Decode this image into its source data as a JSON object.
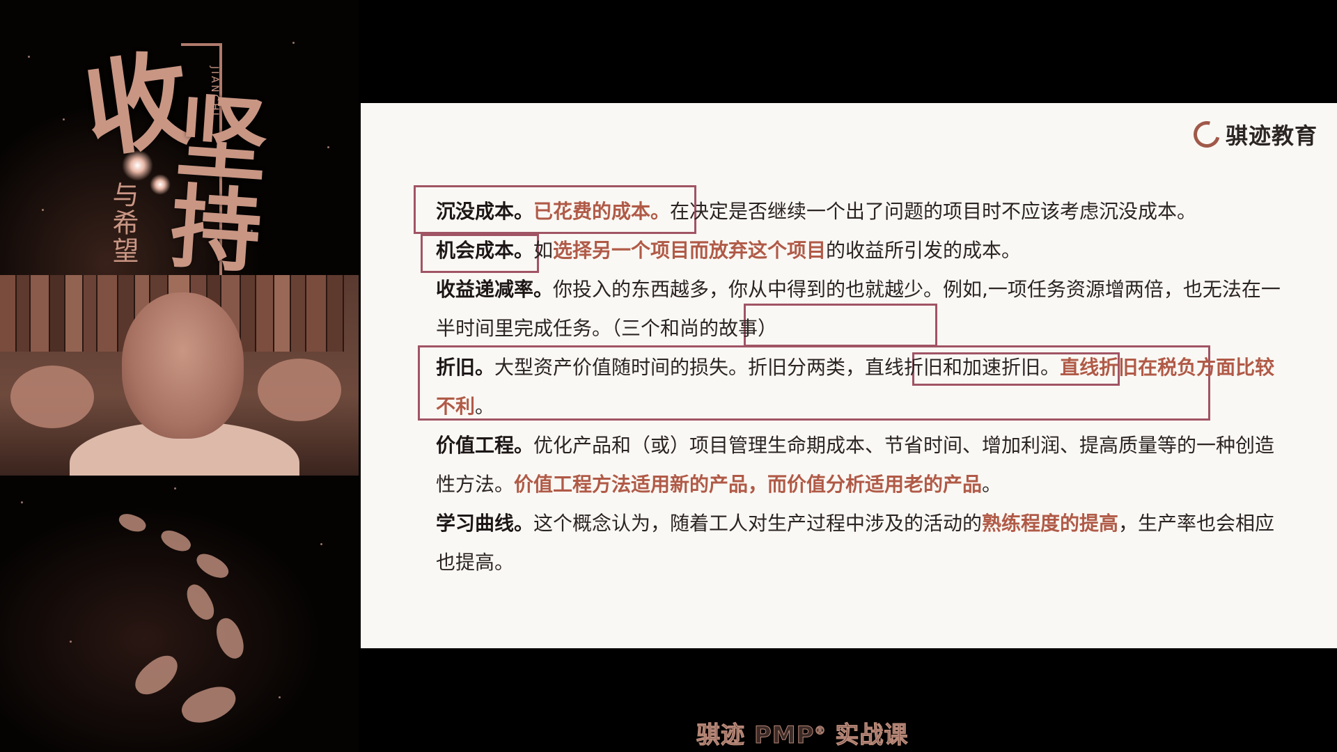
{
  "poster": {
    "char_big_1": "收",
    "char_big_2": "坚持",
    "small_text": "与希望",
    "vertical_text": "JIANCHI"
  },
  "slide": {
    "logo_text": "骐迹教育",
    "items": [
      {
        "term": "沉没成本。",
        "highlight": "已花费的成本",
        "highlight_end": "。",
        "rest": "在决定是否继续一个出了问题的项目时不应该考虑沉没成本。"
      },
      {
        "term": "机会成本。",
        "pre": "如",
        "highlight": "选择另一个项目而放弃这个项目",
        "rest": "的收益所引发的成本。"
      },
      {
        "term": "收益递减率。",
        "rest": "你投入的东西越多，你从中得到的也就越少。例如,一项任务资源增两倍，也无法在一半时间里完成任务。",
        "boxed": "（三个和尚的故事）"
      },
      {
        "term": "折旧。",
        "rest": "大型资产价值随时间的损失。折旧分两类，",
        "boxed": "直线折旧和加速折旧",
        "boxed_end": "。",
        "highlight": "直线折旧在税负方面比较不利",
        "highlight_end": "。"
      },
      {
        "term": "价值工程。",
        "rest": "优化产品和（或）项目管理生命期成本、节省时间、增加利润、提高质量等的一种创造性方法。",
        "highlight": "价值工程方法适用新的产品，而价值分析适用老的产品",
        "highlight_end": "。"
      },
      {
        "term": "学习曲线。",
        "rest": "这个概念认为，随着工人对生产过程中涉及的活动的",
        "highlight": "熟练程度的提高",
        "rest2": "，生产率也会相应也提高。"
      }
    ]
  },
  "caption": {
    "text_before": "骐迹 PMP",
    "reg": "®",
    "text_after": " 实战课"
  },
  "colors": {
    "highlight": "#b05a47",
    "box": "#a05464",
    "slide_bg": "#faf8f4"
  }
}
